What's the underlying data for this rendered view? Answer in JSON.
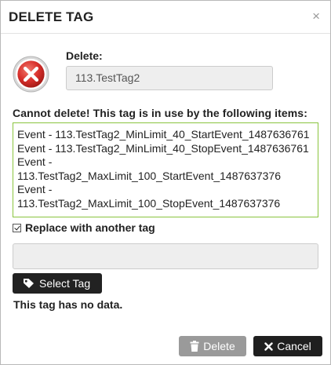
{
  "dialog": {
    "title": "DELETE TAG",
    "close_icon": "close-icon",
    "error_icon": "error-x-icon"
  },
  "delete_field": {
    "label": "Delete:",
    "value": "113.TestTag2"
  },
  "usage": {
    "message": "Cannot delete! This tag is in use by the following items:",
    "items": [
      "Event - 113.TestTag2_MinLimit_40_StartEvent_1487636761",
      "Event - 113.TestTag2_MinLimit_40_StopEvent_1487636761",
      "Event - 113.TestTag2_MaxLimit_100_StartEvent_1487637376",
      "Event - 113.TestTag2_MaxLimit_100_StopEvent_1487637376"
    ]
  },
  "replace": {
    "label": "Replace with another tag",
    "checked": true,
    "value": ""
  },
  "select_tag_button": {
    "label": "Select Tag",
    "icon": "tag-icon"
  },
  "no_data_text": "This tag has no data.",
  "footer": {
    "delete_label": "Delete",
    "delete_icon": "trash-icon",
    "cancel_label": "Cancel",
    "cancel_icon": "times-icon"
  },
  "colors": {
    "items_border": "#8ac43f",
    "error_red": "#d9302c",
    "primary_button": "#222222",
    "disabled_button": "#9a9a9a"
  }
}
